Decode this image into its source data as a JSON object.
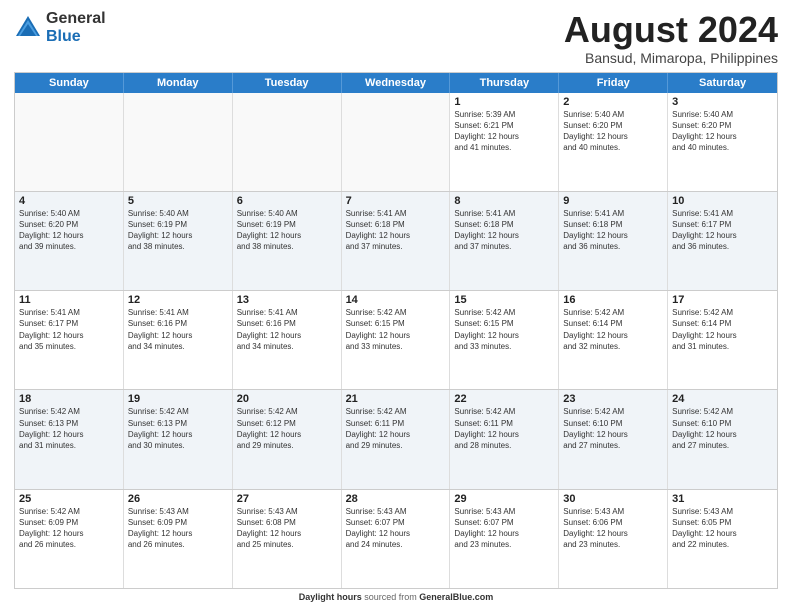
{
  "logo": {
    "general": "General",
    "blue": "Blue"
  },
  "title": "August 2024",
  "subtitle": "Bansud, Mimaropa, Philippines",
  "days_of_week": [
    "Sunday",
    "Monday",
    "Tuesday",
    "Wednesday",
    "Thursday",
    "Friday",
    "Saturday"
  ],
  "weeks": [
    [
      {
        "day": "",
        "info": "",
        "empty": true
      },
      {
        "day": "",
        "info": "",
        "empty": true
      },
      {
        "day": "",
        "info": "",
        "empty": true
      },
      {
        "day": "",
        "info": "",
        "empty": true
      },
      {
        "day": "1",
        "info": "Sunrise: 5:39 AM\nSunset: 6:21 PM\nDaylight: 12 hours\nand 41 minutes.",
        "empty": false
      },
      {
        "day": "2",
        "info": "Sunrise: 5:40 AM\nSunset: 6:20 PM\nDaylight: 12 hours\nand 40 minutes.",
        "empty": false
      },
      {
        "day": "3",
        "info": "Sunrise: 5:40 AM\nSunset: 6:20 PM\nDaylight: 12 hours\nand 40 minutes.",
        "empty": false
      }
    ],
    [
      {
        "day": "4",
        "info": "Sunrise: 5:40 AM\nSunset: 6:20 PM\nDaylight: 12 hours\nand 39 minutes.",
        "empty": false
      },
      {
        "day": "5",
        "info": "Sunrise: 5:40 AM\nSunset: 6:19 PM\nDaylight: 12 hours\nand 38 minutes.",
        "empty": false
      },
      {
        "day": "6",
        "info": "Sunrise: 5:40 AM\nSunset: 6:19 PM\nDaylight: 12 hours\nand 38 minutes.",
        "empty": false
      },
      {
        "day": "7",
        "info": "Sunrise: 5:41 AM\nSunset: 6:18 PM\nDaylight: 12 hours\nand 37 minutes.",
        "empty": false
      },
      {
        "day": "8",
        "info": "Sunrise: 5:41 AM\nSunset: 6:18 PM\nDaylight: 12 hours\nand 37 minutes.",
        "empty": false
      },
      {
        "day": "9",
        "info": "Sunrise: 5:41 AM\nSunset: 6:18 PM\nDaylight: 12 hours\nand 36 minutes.",
        "empty": false
      },
      {
        "day": "10",
        "info": "Sunrise: 5:41 AM\nSunset: 6:17 PM\nDaylight: 12 hours\nand 36 minutes.",
        "empty": false
      }
    ],
    [
      {
        "day": "11",
        "info": "Sunrise: 5:41 AM\nSunset: 6:17 PM\nDaylight: 12 hours\nand 35 minutes.",
        "empty": false
      },
      {
        "day": "12",
        "info": "Sunrise: 5:41 AM\nSunset: 6:16 PM\nDaylight: 12 hours\nand 34 minutes.",
        "empty": false
      },
      {
        "day": "13",
        "info": "Sunrise: 5:41 AM\nSunset: 6:16 PM\nDaylight: 12 hours\nand 34 minutes.",
        "empty": false
      },
      {
        "day": "14",
        "info": "Sunrise: 5:42 AM\nSunset: 6:15 PM\nDaylight: 12 hours\nand 33 minutes.",
        "empty": false
      },
      {
        "day": "15",
        "info": "Sunrise: 5:42 AM\nSunset: 6:15 PM\nDaylight: 12 hours\nand 33 minutes.",
        "empty": false
      },
      {
        "day": "16",
        "info": "Sunrise: 5:42 AM\nSunset: 6:14 PM\nDaylight: 12 hours\nand 32 minutes.",
        "empty": false
      },
      {
        "day": "17",
        "info": "Sunrise: 5:42 AM\nSunset: 6:14 PM\nDaylight: 12 hours\nand 31 minutes.",
        "empty": false
      }
    ],
    [
      {
        "day": "18",
        "info": "Sunrise: 5:42 AM\nSunset: 6:13 PM\nDaylight: 12 hours\nand 31 minutes.",
        "empty": false
      },
      {
        "day": "19",
        "info": "Sunrise: 5:42 AM\nSunset: 6:13 PM\nDaylight: 12 hours\nand 30 minutes.",
        "empty": false
      },
      {
        "day": "20",
        "info": "Sunrise: 5:42 AM\nSunset: 6:12 PM\nDaylight: 12 hours\nand 29 minutes.",
        "empty": false
      },
      {
        "day": "21",
        "info": "Sunrise: 5:42 AM\nSunset: 6:11 PM\nDaylight: 12 hours\nand 29 minutes.",
        "empty": false
      },
      {
        "day": "22",
        "info": "Sunrise: 5:42 AM\nSunset: 6:11 PM\nDaylight: 12 hours\nand 28 minutes.",
        "empty": false
      },
      {
        "day": "23",
        "info": "Sunrise: 5:42 AM\nSunset: 6:10 PM\nDaylight: 12 hours\nand 27 minutes.",
        "empty": false
      },
      {
        "day": "24",
        "info": "Sunrise: 5:42 AM\nSunset: 6:10 PM\nDaylight: 12 hours\nand 27 minutes.",
        "empty": false
      }
    ],
    [
      {
        "day": "25",
        "info": "Sunrise: 5:42 AM\nSunset: 6:09 PM\nDaylight: 12 hours\nand 26 minutes.",
        "empty": false
      },
      {
        "day": "26",
        "info": "Sunrise: 5:43 AM\nSunset: 6:09 PM\nDaylight: 12 hours\nand 26 minutes.",
        "empty": false
      },
      {
        "day": "27",
        "info": "Sunrise: 5:43 AM\nSunset: 6:08 PM\nDaylight: 12 hours\nand 25 minutes.",
        "empty": false
      },
      {
        "day": "28",
        "info": "Sunrise: 5:43 AM\nSunset: 6:07 PM\nDaylight: 12 hours\nand 24 minutes.",
        "empty": false
      },
      {
        "day": "29",
        "info": "Sunrise: 5:43 AM\nSunset: 6:07 PM\nDaylight: 12 hours\nand 23 minutes.",
        "empty": false
      },
      {
        "day": "30",
        "info": "Sunrise: 5:43 AM\nSunset: 6:06 PM\nDaylight: 12 hours\nand 23 minutes.",
        "empty": false
      },
      {
        "day": "31",
        "info": "Sunrise: 5:43 AM\nSunset: 6:05 PM\nDaylight: 12 hours\nand 22 minutes.",
        "empty": false
      }
    ]
  ],
  "footer": {
    "label": "Daylight hours",
    "source": "GeneralBlue.com"
  }
}
